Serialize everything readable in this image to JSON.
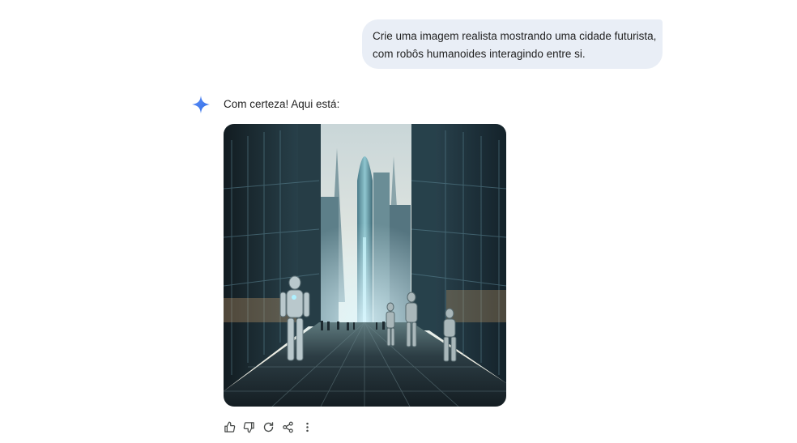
{
  "user_message": {
    "line1": "Crie uma imagem realista mostrando uma cidade futurista,",
    "line2": "com robôs humanoides interagindo entre si."
  },
  "assistant": {
    "icon": "sparkle-icon",
    "reply_text": "Com certeza! Aqui está:",
    "image": {
      "subject": "generated-image"
    },
    "actions": [
      {
        "icon": "thumbs-up-icon"
      },
      {
        "icon": "thumbs-down-icon"
      },
      {
        "icon": "regenerate-icon"
      },
      {
        "icon": "share-icon"
      },
      {
        "icon": "more-vert-icon"
      }
    ]
  },
  "colors": {
    "user_bubble": "#e9eef6",
    "sparkle_accent": "#4285f4",
    "text": "#1f1f1f",
    "icon": "#444746"
  }
}
